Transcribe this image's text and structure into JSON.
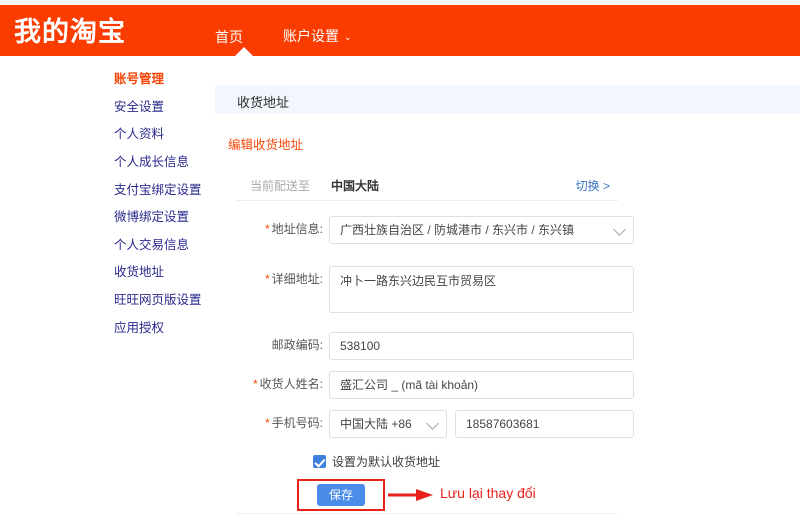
{
  "header": {
    "logo": "我的淘宝",
    "nav": [
      {
        "label": "首页",
        "active": true
      },
      {
        "label": "账户设置",
        "caret": "⌄",
        "active": false
      }
    ]
  },
  "sidebar": {
    "items": [
      {
        "label": "账号管理",
        "active": true
      },
      {
        "label": "安全设置",
        "active": false
      },
      {
        "label": "个人资料",
        "active": false
      },
      {
        "label": "个人成长信息",
        "active": false
      },
      {
        "label": "支付宝绑定设置",
        "active": false
      },
      {
        "label": "微博绑定设置",
        "active": false
      },
      {
        "label": "个人交易信息",
        "active": false
      },
      {
        "label": "收货地址",
        "active": false
      },
      {
        "label": "旺旺网页版设置",
        "active": false
      },
      {
        "label": "应用授权",
        "active": false
      }
    ]
  },
  "main": {
    "panel_title": "收货地址",
    "section_title": "编辑收货地址",
    "shipping": {
      "label": "当前配送至",
      "value": "中国大陆",
      "switch_label": "切换 >"
    },
    "form": {
      "address_info": {
        "label": "地址信息:",
        "required": "*",
        "value": "广西壮族自治区 / 防城港市 / 东兴市 / 东兴镇"
      },
      "detail_address": {
        "label": "详细地址:",
        "required": "*",
        "value": "冲卜一路东兴边民互市贸易区"
      },
      "postcode": {
        "label": "邮政编码:",
        "required": "",
        "value": "538100"
      },
      "recipient": {
        "label": "收货人姓名:",
        "required": "*",
        "value": "盛汇公司 _ (mã tài khoản)"
      },
      "phone": {
        "label": "手机号码:",
        "required": "*",
        "country_code": "中国大陆 +86",
        "number": "18587603681"
      }
    },
    "default_checkbox": {
      "label": "设置为默认收货地址",
      "checked": true
    },
    "save_label": "保存",
    "annotation": "Lưu lại thay đổi"
  },
  "colors": {
    "brand_orange": "#fa3c00",
    "accent_red": "#e8221a",
    "button_blue": "#4a8ce8",
    "link_blue": "#3b74c4",
    "panel_blue": "#f2f6fd"
  }
}
